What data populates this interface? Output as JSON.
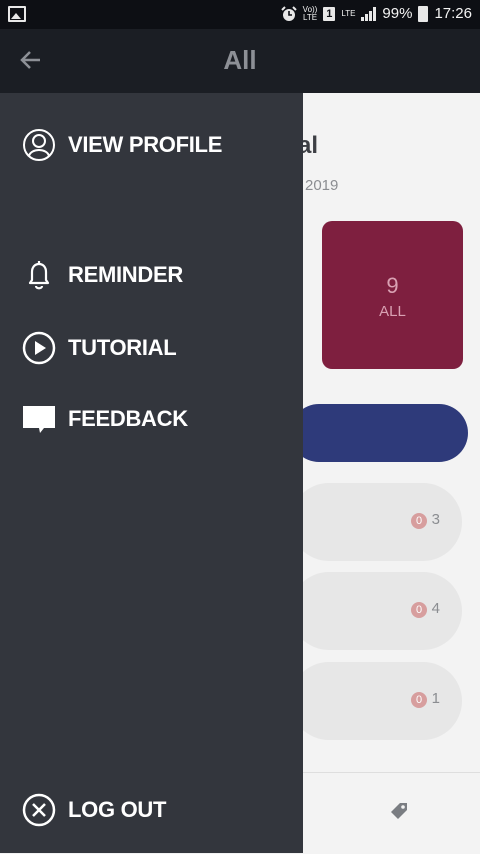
{
  "status_bar": {
    "volte_top": "Vo))",
    "volte_bottom": "LTE",
    "sim_label": "1",
    "lte_label": "LTE",
    "battery_percent": "99%",
    "time": "17:26"
  },
  "app_bar": {
    "title": "All",
    "back_icon": "arrow-left-icon"
  },
  "background": {
    "heading_fragment": "al",
    "date_fragment": "2019",
    "all_card": {
      "count": "9",
      "label": "ALL",
      "color": "#7e1f3f"
    },
    "rows": [
      {
        "badge": "0",
        "count": "3"
      },
      {
        "badge": "0",
        "count": "4"
      },
      {
        "badge": "0",
        "count": "1"
      }
    ]
  },
  "drawer": {
    "items": [
      {
        "label": "VIEW PROFILE",
        "icon": "profile-icon"
      },
      {
        "label": "REMINDER",
        "icon": "bell-icon"
      },
      {
        "label": "TUTORIAL",
        "icon": "play-circle-icon"
      },
      {
        "label": "FEEDBACK",
        "icon": "speech-bubble-icon"
      }
    ],
    "logout": {
      "label": "LOG OUT",
      "icon": "close-circle-icon"
    }
  }
}
